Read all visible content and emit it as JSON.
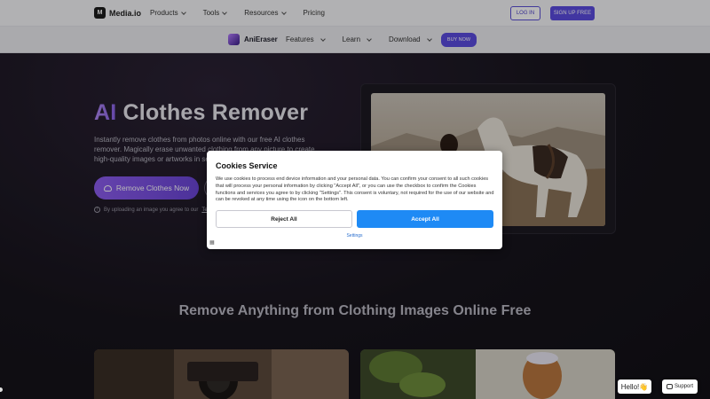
{
  "topnav": {
    "brand": "Media.io",
    "logo_glyph": "M",
    "menu": [
      "Products",
      "Tools",
      "Resources",
      "Pricing"
    ],
    "login": "LOG IN",
    "signup": "SIGN UP FREE"
  },
  "subnav": {
    "brand": "AniEraser",
    "menu": [
      "Features",
      "Learn",
      "Download"
    ],
    "buy": "BUY NOW"
  },
  "hero": {
    "title_ai": "AI",
    "title_rest": " Clothes Remover",
    "description": "Instantly remove clothes from photos online with our free AI clothes remover. Magically erase unwanted clothing from any picture to create high-quality images or artworks in se",
    "cta": "Remove Clothes Now",
    "upload_note": "By uploading an image you agree to our",
    "terms_link": "Ter"
  },
  "section": {
    "title": "Remove Anything from Clothing Images Online Free"
  },
  "cookie": {
    "title": "Cookies Service",
    "body": "We use cookies to process end device information and your personal data. You can confirm your consent to all such cookies that will process your personal information by clicking \"Accept All\", or you can use the checkbox to confirm the Cookies functions and services you agree to by clicking \"Settings\". This consent is voluntary, not required for the use of our website and can be revoked at any time using the icon on the bottom left.",
    "reject": "Reject All",
    "accept": "Accept All",
    "settings": "Settings"
  },
  "widgets": {
    "hello": "Hello!👋",
    "support": "Support"
  },
  "colors": {
    "accent": "#5b4ce0",
    "accept_blue": "#1e8af5",
    "hero_bg": "#141218"
  }
}
